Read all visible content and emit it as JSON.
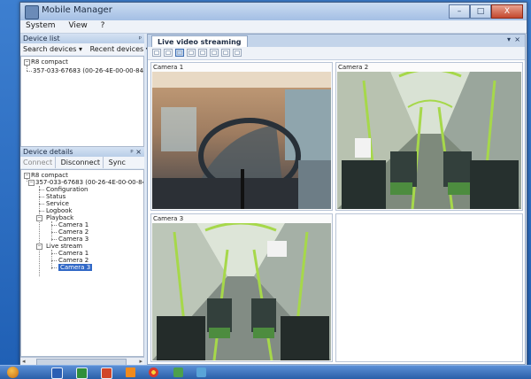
{
  "window": {
    "title": "Mobile Manager"
  },
  "caption_buttons": [
    "–",
    "□",
    "X"
  ],
  "menu": [
    "System",
    "View",
    "?"
  ],
  "device_list": {
    "title": "Device list",
    "pin": "ᵖ",
    "toolbar": [
      "Search devices ▾",
      "Recent devices ▾"
    ],
    "root": "R8 compact",
    "child": "357-033-67683 (00-26-4E-00-00-84)"
  },
  "device_details": {
    "title": "Device details",
    "pin": "ᵖ ×",
    "toolbar": [
      "Connect",
      "Disconnect",
      "Sync"
    ],
    "root": "R8 compact",
    "device": "357-033-67683 (00-26-4E-00-00-84) (co",
    "items": [
      "Configuration",
      "Status",
      "Service",
      "Logbook"
    ],
    "playback": "Playback",
    "playback_cameras": [
      "Camera 1",
      "Camera 2",
      "Camera 3"
    ],
    "live_stream": "Live stream",
    "live_cameras": [
      "Camera 1",
      "Camera 2",
      "Camera 3"
    ]
  },
  "main": {
    "tab": "Live video streaming",
    "tab_controls": [
      "▾",
      "×"
    ],
    "cameras": [
      "Camera 1",
      "Camera 2",
      "Camera 3"
    ],
    "close_glyph": "×"
  },
  "colors": {
    "accent": "#3168c6",
    "title_gradient_top": "#c9dbf1",
    "close_red": "#d04a36"
  },
  "taskbar_icons": [
    "windows-start",
    "word-icon",
    "excel-icon",
    "powerpoint-icon",
    "vlc-icon",
    "chrome-icon",
    "app-icon-1",
    "app-icon-2"
  ]
}
